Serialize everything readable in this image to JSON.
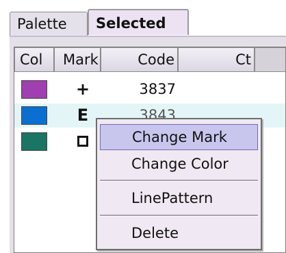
{
  "tabs": [
    {
      "label": "Palette",
      "active": false
    },
    {
      "label": "Selected",
      "active": true
    }
  ],
  "table": {
    "columns": [
      "Col",
      "Mark",
      "Code",
      "Ct"
    ],
    "rows": [
      {
        "color": "#a040b0",
        "mark": "+",
        "mark_icon": "plus-mark",
        "code": "3837"
      },
      {
        "color": "#0a6fd0",
        "mark": "E",
        "mark_icon": "e-mark",
        "code": "3843",
        "highlighted": true
      },
      {
        "color": "#1a7565",
        "mark": "",
        "mark_icon": "hollow-square-mark",
        "code": ""
      }
    ]
  },
  "context_menu": {
    "items": [
      {
        "label": "Change Mark",
        "highlighted": true
      },
      {
        "label": "Change Color"
      },
      {
        "label": "LinePattern"
      },
      {
        "label": "Delete"
      }
    ]
  },
  "colors": {
    "tab_bg": "#e4e1ea",
    "selected_tab_bg": "#ece2f2",
    "menu_bg": "#f0e8f2",
    "menu_highlight": "#c9c6ee",
    "row_highlight": "#e4f5f8"
  }
}
